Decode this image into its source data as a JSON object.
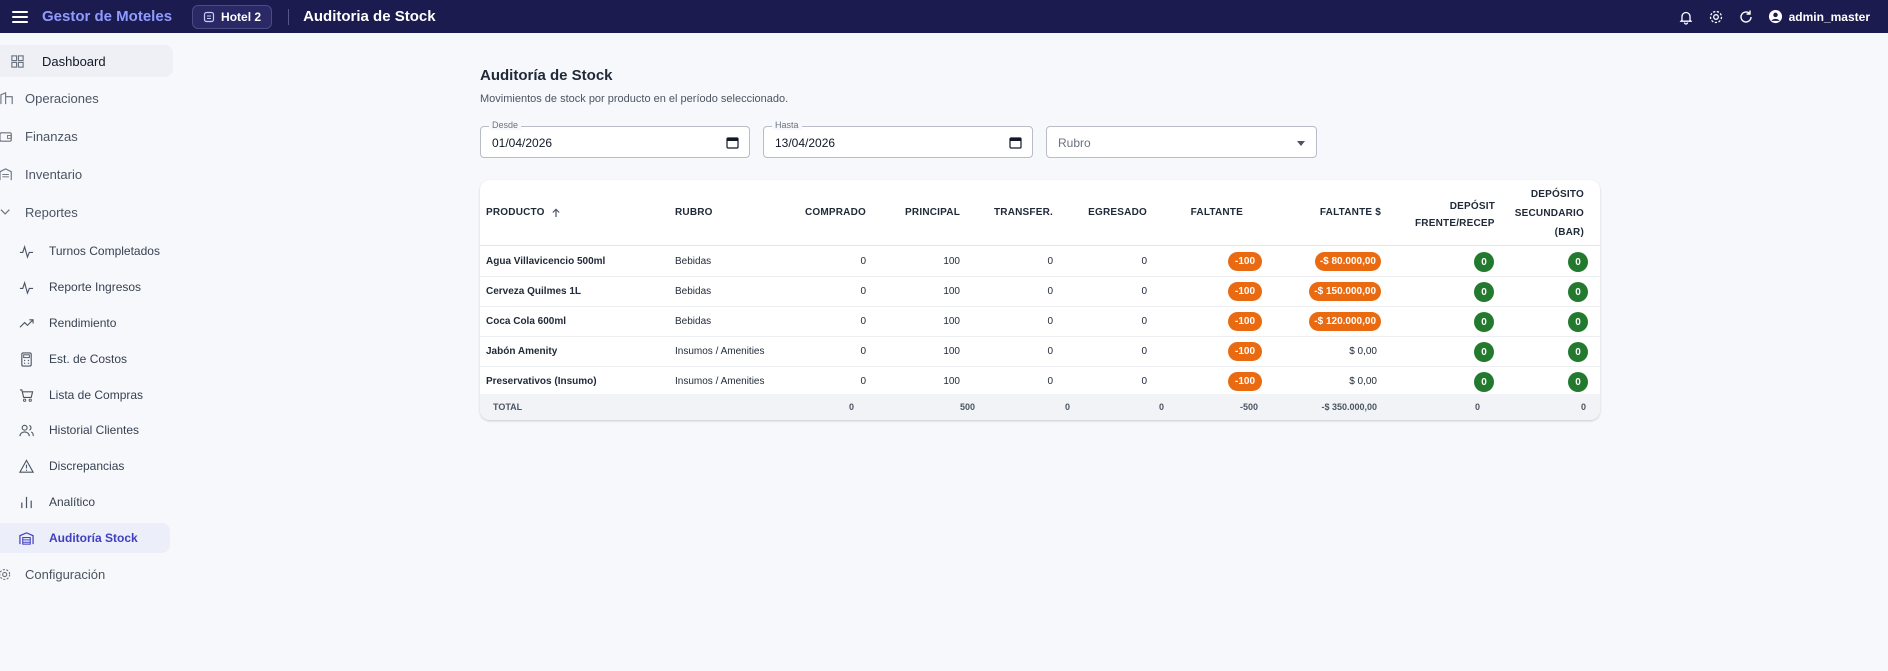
{
  "topbar": {
    "brand": "Gestor de Moteles",
    "hotel": "Hotel 2",
    "title": "Auditoria de Stock",
    "user": "admin_master"
  },
  "sidebar": {
    "items": [
      {
        "label": "Dashboard",
        "icon": "dashboard-icon"
      },
      {
        "label": "Operaciones",
        "icon": "building-icon"
      },
      {
        "label": "Finanzas",
        "icon": "wallet-icon"
      },
      {
        "label": "Inventario",
        "icon": "warehouse-icon"
      },
      {
        "label": "Reportes",
        "icon": "chevron-down-icon"
      }
    ],
    "reportes": [
      {
        "label": "Turnos Completados",
        "icon": "activity-icon"
      },
      {
        "label": "Reporte Ingresos",
        "icon": "activity-icon"
      },
      {
        "label": "Rendimiento",
        "icon": "trending-up-icon"
      },
      {
        "label": "Est. de Costos",
        "icon": "calculator-icon"
      },
      {
        "label": "Lista de Compras",
        "icon": "cart-icon"
      },
      {
        "label": "Historial Clientes",
        "icon": "users-icon"
      },
      {
        "label": "Discrepancias",
        "icon": "warning-icon"
      },
      {
        "label": "Analítico",
        "icon": "bar-chart-icon"
      },
      {
        "label": "Auditoría Stock",
        "icon": "warehouse-icon"
      }
    ],
    "config": {
      "label": "Configuración",
      "icon": "gear-icon"
    }
  },
  "main": {
    "title": "Auditoría de Stock",
    "subtitle": "Movimientos de stock por producto en el período seleccionado.",
    "filters": {
      "desde_label": "Desde",
      "desde_value": "01/04/2026",
      "hasta_label": "Hasta",
      "hasta_value": "13/04/2026",
      "rubro_placeholder": "Rubro"
    }
  },
  "table": {
    "headers": {
      "producto": "PRODUCTO",
      "rubro": "RUBRO",
      "comprado": "COMPRADO",
      "principal": "PRINCIPAL",
      "transfer": "TRANSFER.",
      "egresado": "EGRESADO",
      "faltante": "FALTANTE",
      "faltante_s": "FALTANTE $",
      "deposit_frente_1": "DEPÓSIT",
      "deposit_frente_2": "FRENTE/RECEPC",
      "deposito_sec_1": "DEPÓSITO",
      "deposito_sec_2": "SECUNDARIO",
      "deposito_sec_3": "(BAR)"
    },
    "rows": [
      {
        "producto": "Agua Villavicencio 500ml",
        "rubro": "Bebidas",
        "comprado": "0",
        "principal": "100",
        "transfer": "0",
        "egresado": "0",
        "faltante": "-100",
        "faltante_s": "-$ 80.000,00",
        "faltante_s_pill": true,
        "frente": "0",
        "secundario": "0"
      },
      {
        "producto": "Cerveza Quilmes 1L",
        "rubro": "Bebidas",
        "comprado": "0",
        "principal": "100",
        "transfer": "0",
        "egresado": "0",
        "faltante": "-100",
        "faltante_s": "-$ 150.000,00",
        "faltante_s_pill": true,
        "frente": "0",
        "secundario": "0"
      },
      {
        "producto": "Coca Cola 600ml",
        "rubro": "Bebidas",
        "comprado": "0",
        "principal": "100",
        "transfer": "0",
        "egresado": "0",
        "faltante": "-100",
        "faltante_s": "-$ 120.000,00",
        "faltante_s_pill": true,
        "frente": "0",
        "secundario": "0"
      },
      {
        "producto": "Jabón Amenity",
        "rubro": "Insumos / Amenities",
        "comprado": "0",
        "principal": "100",
        "transfer": "0",
        "egresado": "0",
        "faltante": "-100",
        "faltante_s": "$ 0,00",
        "faltante_s_pill": false,
        "frente": "0",
        "secundario": "0"
      },
      {
        "producto": "Preservativos (Insumo)",
        "rubro": "Insumos / Amenities",
        "comprado": "0",
        "principal": "100",
        "transfer": "0",
        "egresado": "0",
        "faltante": "-100",
        "faltante_s": "$ 0,00",
        "faltante_s_pill": false,
        "frente": "0",
        "secundario": "0"
      }
    ],
    "total": {
      "label": "TOTAL",
      "comprado": "0",
      "principal": "500",
      "transfer": "0",
      "egresado": "0",
      "faltante": "-500",
      "faltante_s": "-$ 350.000,00",
      "frente": "0",
      "secundario": "0"
    }
  },
  "colors": {
    "topbar": "#1c1b4f",
    "brand": "#8f9cff",
    "accent": "#3f3fbf",
    "orange_pill": "#ea6a12",
    "green_pill": "#237a2f"
  }
}
